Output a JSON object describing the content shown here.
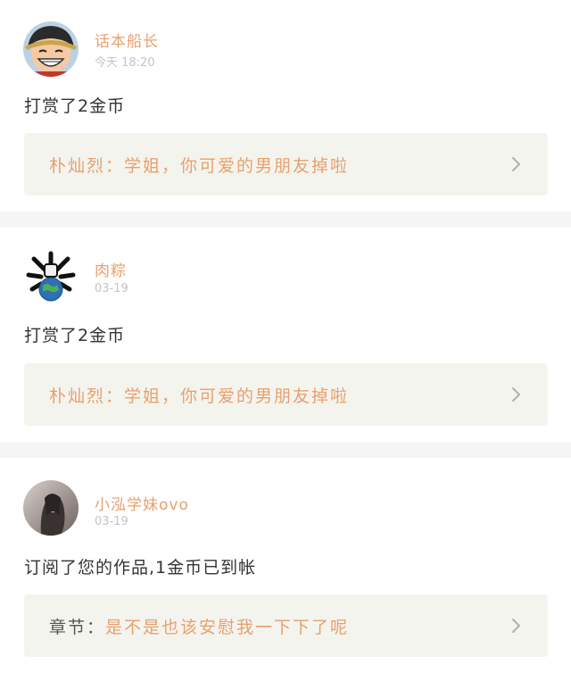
{
  "feed": {
    "items": [
      {
        "username": "话本船长",
        "timestamp": "今天 18:20",
        "action": "打赏了2金币",
        "quote_prefix": "朴灿烈：",
        "quote_text": "学姐，你可爱的男朋友掉啦",
        "avatar": "straw-hat-cartoon-avatar"
      },
      {
        "username": "肉粽",
        "timestamp": "03-19",
        "action": "打赏了2金币",
        "quote_prefix": "朴灿烈：",
        "quote_text": "学姐，你可爱的男朋友掉啦",
        "avatar": "globe-bones-avatar"
      },
      {
        "username": "小泓学妹ovo",
        "timestamp": "03-19",
        "action": "订阅了您的作品,1金币已到帐",
        "quote_prefix": "章节：",
        "quote_text": "是不是也该安慰我一下下了呢",
        "avatar": "photo-avatar"
      }
    ]
  },
  "colors": {
    "accent": "#e8a06d",
    "timestamp": "#c4c4c4",
    "quote_bg": "#f4f4ef",
    "separator": "#f5f5f5"
  }
}
